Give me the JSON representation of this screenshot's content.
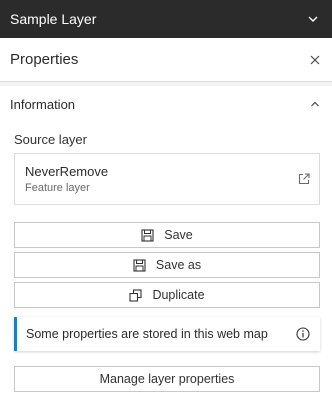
{
  "header": {
    "title": "Sample Layer",
    "icon": "chevron-down-icon"
  },
  "panel": {
    "title": "Properties",
    "close_icon": "close-icon"
  },
  "section": {
    "title": "Information",
    "toggle_icon": "chevron-up-icon",
    "source_label": "Source layer",
    "layer": {
      "name": "NeverRemove",
      "type": "Feature layer",
      "icon": "external-link-icon"
    },
    "buttons": [
      {
        "label": "Save",
        "icon": "save-icon"
      },
      {
        "label": "Save as",
        "icon": "save-as-icon"
      },
      {
        "label": "Duplicate",
        "icon": "duplicate-icon"
      }
    ],
    "notice": {
      "text": "Some properties are stored in this web map",
      "icon": "info-icon",
      "accent": "#1f7fb8"
    },
    "manage_label": "Manage layer properties"
  }
}
